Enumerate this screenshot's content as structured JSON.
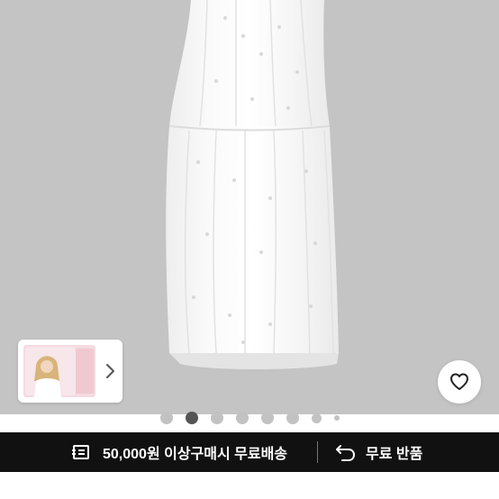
{
  "gallery": {
    "image": "white-eyelet-maxi-dress",
    "background_color": "#c4c4c4",
    "total_images": 8,
    "active_index": 1
  },
  "thumbnail": {
    "image": "model-thumbnail",
    "next_icon": "chevron-right-icon"
  },
  "wishlist": {
    "icon": "heart-outline-icon"
  },
  "banner": {
    "shipping_icon": "delivery-truck-icon",
    "shipping_text": "50,000원 이상구매시 무료배송",
    "return_icon": "return-arrow-icon",
    "return_text": "무료 반품"
  }
}
